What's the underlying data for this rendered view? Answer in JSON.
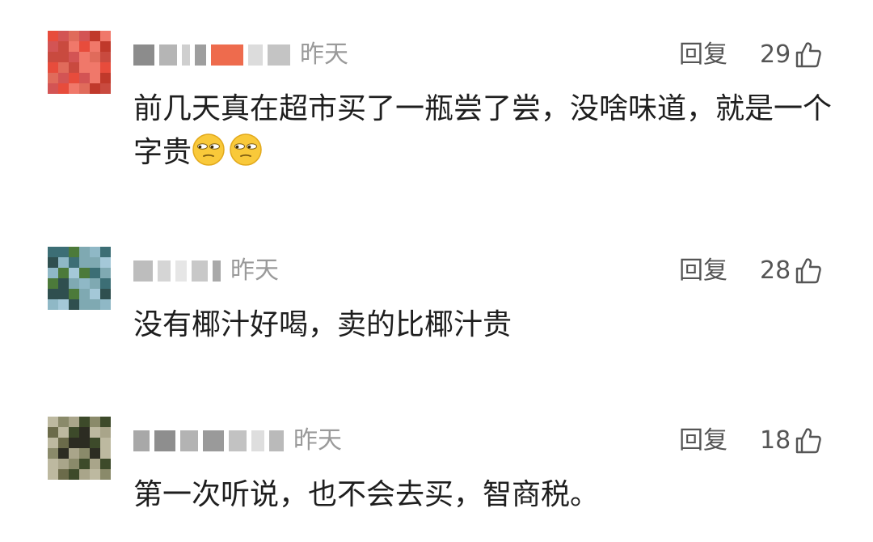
{
  "comments": [
    {
      "time": "昨天",
      "reply_label": "回复",
      "likes": "29",
      "text": "前几天真在超市买了一瓶尝了尝，没啥味道，就是一个字贵",
      "emoji": "unamused-face-emoji",
      "emoji_count": 2,
      "avatar_colors": [
        "#c0392b",
        "#e74c3c",
        "#d35454",
        "#e06b5b",
        "#c94a3f",
        "#f0786a"
      ]
    },
    {
      "time": "昨天",
      "reply_label": "回复",
      "likes": "28",
      "text": "没有椰汁好喝，卖的比椰汁贵",
      "avatar_colors": [
        "#3c6e75",
        "#8fb8c6",
        "#4c7a3a",
        "#a4c8d8",
        "#2f4f4f",
        "#7fa9b2"
      ]
    },
    {
      "time": "昨天",
      "reply_label": "回复",
      "likes": "18",
      "text": "第一次听说，也不会去买，智商税。",
      "avatar_colors": [
        "#6b6b4a",
        "#a9a58a",
        "#3d4a2a",
        "#8a8a6a",
        "#2c2c22",
        "#bdb9a0"
      ]
    }
  ],
  "icons": {
    "like": "thumbs-up-outline-icon"
  },
  "colors": {
    "meta_text": "#9a9a9a",
    "action_text": "#555555",
    "body_text": "#1e1e1e"
  }
}
